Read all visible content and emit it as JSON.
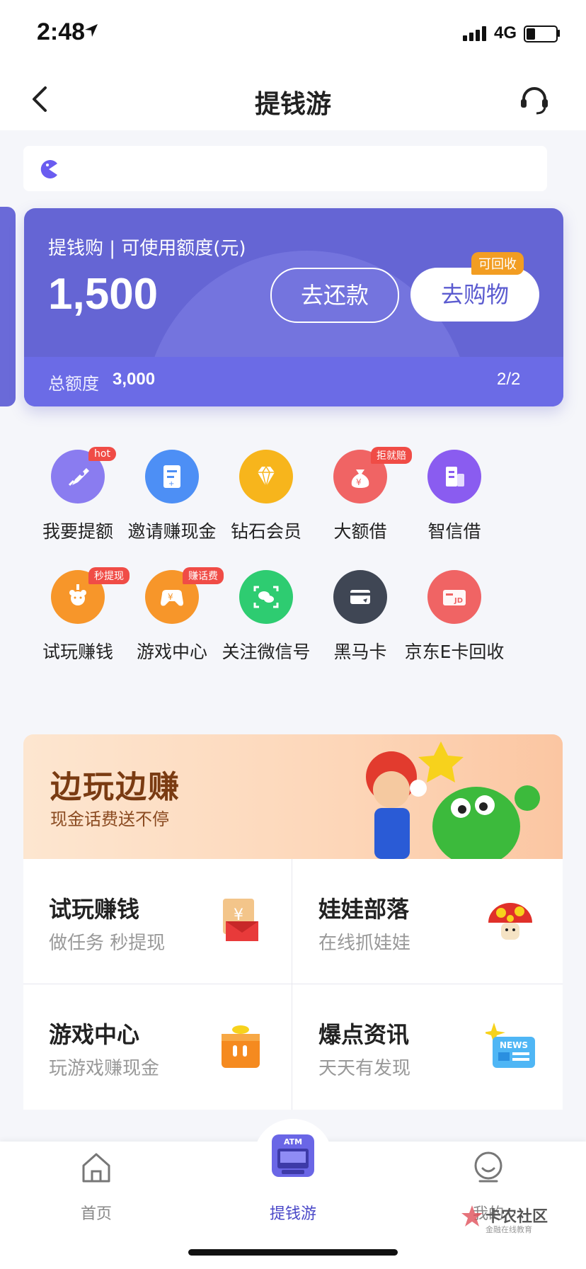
{
  "status_bar": {
    "time": "2:48",
    "network": "4G",
    "battery_level": 0.3
  },
  "nav": {
    "title": "提钱游"
  },
  "card": {
    "label": "提钱购 | 可使用额度(元)",
    "amount": "1,500",
    "repay_label": "去还款",
    "shop_label": "去购物",
    "shop_badge": "可回收",
    "total_label": "总额度",
    "total_value": "3,000",
    "page": "2/2",
    "colors": {
      "primary": "#6565d4",
      "accent": "#f29d22"
    }
  },
  "grid": [
    {
      "label": "我要提额",
      "badge": "hot",
      "icon": "rocket-icon",
      "color": "#8a7cf0"
    },
    {
      "label": "邀请赚现金",
      "badge": "",
      "icon": "invite-icon",
      "color": "#4d8ff5"
    },
    {
      "label": "钻石会员",
      "badge": "",
      "icon": "diamond-icon",
      "color": "#f7b51c"
    },
    {
      "label": "大额借",
      "badge": "拒就赔",
      "icon": "money-bag-icon",
      "color": "#f06464"
    },
    {
      "label": "智信借",
      "badge": "",
      "icon": "building-icon",
      "color": "#8a5cf0"
    },
    {
      "label": "试玩赚钱",
      "badge": "秒提现",
      "icon": "claw-icon",
      "color": "#f7962a"
    },
    {
      "label": "游戏中心",
      "badge": "赚话费",
      "icon": "gamepad-icon",
      "color": "#f7962a"
    },
    {
      "label": "关注微信号",
      "badge": "",
      "icon": "wechat-icon",
      "color": "#2ecc71"
    },
    {
      "label": "黑马卡",
      "badge": "",
      "icon": "card-icon",
      "color": "#3f4654"
    },
    {
      "label": "京东E卡回收",
      "badge": "",
      "icon": "jd-card-icon",
      "color": "#f06464"
    }
  ],
  "banner": {
    "title": "边玩边赚",
    "subtitle": "现金话费送不停"
  },
  "tiles": [
    {
      "title": "试玩赚钱",
      "subtitle": "做任务 秒提现",
      "icon": "red-envelope-icon"
    },
    {
      "title": "娃娃部落",
      "subtitle": "在线抓娃娃",
      "icon": "mushroom-icon"
    },
    {
      "title": "游戏中心",
      "subtitle": "玩游戏赚现金",
      "icon": "gift-box-icon"
    },
    {
      "title": "爆点资讯",
      "subtitle": "天天有发现",
      "icon": "news-icon",
      "news_text": "NEWS"
    }
  ],
  "tabs": [
    {
      "label": "首页",
      "icon": "home-icon",
      "active": false
    },
    {
      "label": "提钱游",
      "icon": "atm-icon",
      "active": true,
      "atm_text": "ATM"
    },
    {
      "label": "我的",
      "icon": "profile-icon",
      "active": false
    }
  ],
  "watermark": {
    "text": "卡农社区",
    "sub": "金融在线教育"
  }
}
